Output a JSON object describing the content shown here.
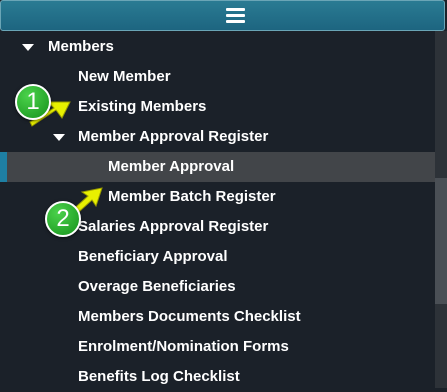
{
  "menu": {
    "items": [
      {
        "label": "Members",
        "expanded": true
      },
      {
        "label": "New Member"
      },
      {
        "label": "Existing Members"
      },
      {
        "label": "Member Approval Register",
        "expanded": true
      },
      {
        "label": "Member Approval",
        "selected": true
      },
      {
        "label": "Member Batch Register"
      },
      {
        "label": "Salaries Approval Register"
      },
      {
        "label": "Beneficiary Approval"
      },
      {
        "label": "Overage Beneficiaries"
      },
      {
        "label": "Members Documents Checklist"
      },
      {
        "label": "Enrolment/Nomination Forms"
      },
      {
        "label": "Benefits Log Checklist"
      }
    ]
  },
  "annotations": {
    "step1": "1",
    "step2": "2"
  },
  "colors": {
    "background": "#1b2129",
    "topbar": "#1f6b86",
    "selected_row": "#424549",
    "active_marker": "#1e7fa3",
    "annotation_badge": "#1f9a25",
    "annotation_arrow": "#e8f000"
  },
  "icons": {
    "topbar": "hamburger-menu-icon",
    "expanded": "caret-down-icon"
  }
}
